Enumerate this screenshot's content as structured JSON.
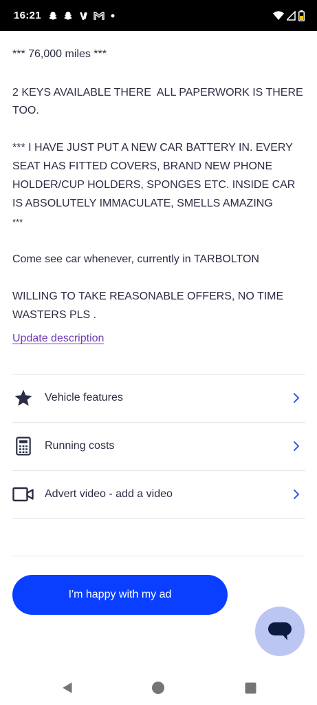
{
  "status_bar": {
    "time": "16:21",
    "left_icons": [
      "snapchat-icon",
      "snapchat-icon",
      "v-app-icon",
      "gmail-icon",
      "dot-icon"
    ],
    "right_icons": [
      "wifi-icon",
      "cell-signal-icon",
      "battery-icon"
    ]
  },
  "description": {
    "lines": [
      "*** 76,000 miles ***",
      "2 KEYS AVAILABLE THERE  ALL PAPERWORK IS THERE",
      "TOO.",
      "*** I HAVE JUST PUT A NEW CAR BATTERY IN. EVERY",
      "SEAT HAS FITTED COVERS, BRAND NEW PHONE",
      "HOLDER/CUP HOLDERS, SPONGES ETC. INSIDE CAR",
      "IS ABSOLUTELY IMMACULATE, SMELLS AMAZING",
      "***",
      "Come see car whenever, currently in TARBOLTON",
      "WILLING TO TAKE REASONABLE OFFERS, NO TIME",
      "WASTERS PLS ."
    ],
    "update_link": "Update description"
  },
  "sections": [
    {
      "label": "Vehicle features",
      "icon": "star-icon"
    },
    {
      "label": "Running costs",
      "icon": "calculator-icon"
    },
    {
      "label": "Advert video - add a video",
      "icon": "video-camera-icon"
    }
  ],
  "primary_button": "I'm happy with my ad",
  "chat_button": {
    "icon": "chat-bubble-icon"
  },
  "nav": {
    "icons": [
      "back-icon",
      "home-icon",
      "recents-icon"
    ]
  },
  "colors": {
    "primary": "#0a3fff",
    "link": "#6e3bb5",
    "text": "#2b2d44",
    "chevron": "#3a5bd9",
    "fab": "#bcc6f3"
  }
}
